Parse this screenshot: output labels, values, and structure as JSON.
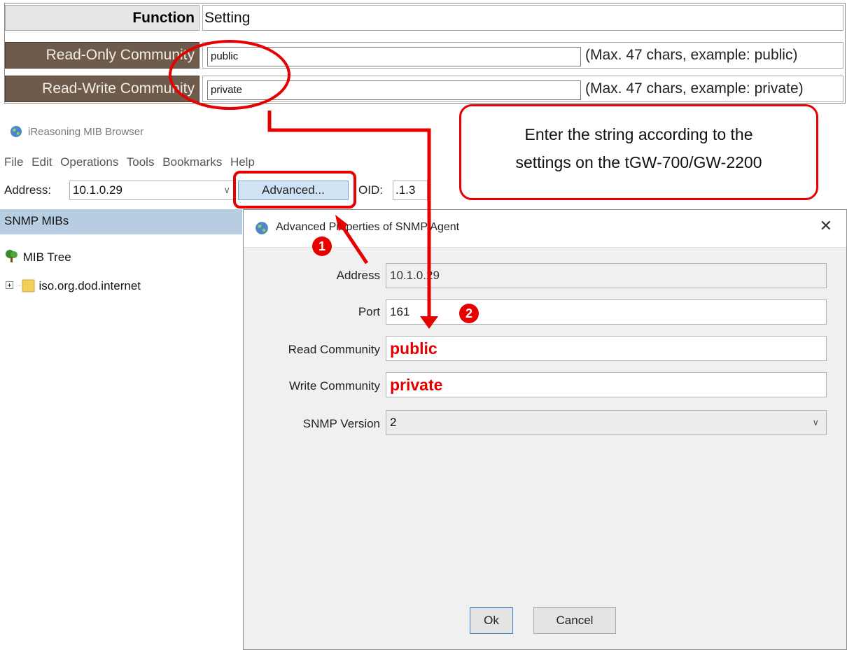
{
  "settings_table": {
    "header_label": "Function",
    "header_value": "Setting",
    "rows": [
      {
        "label": "Read-Only Community",
        "value": "public",
        "hint": "(Max. 47 chars, example: public)"
      },
      {
        "label": "Read-Write Community",
        "value": "private",
        "hint": "(Max. 47 chars, example: private)"
      }
    ]
  },
  "app": {
    "title": "iReasoning MIB Browser",
    "menu": [
      "File",
      "Edit",
      "Operations",
      "Tools",
      "Bookmarks",
      "Help"
    ],
    "address_label": "Address:",
    "address_value": "10.1.0.29",
    "advanced_button": "Advanced...",
    "oid_label": "OID:",
    "oid_value": ".1.3",
    "panel_header": "SNMP MIBs",
    "tree_root": "MIB Tree",
    "tree_child": "iso.org.dod.internet"
  },
  "dialog": {
    "title": "Advanced Properties of SNMP Agent",
    "close_glyph": "✕",
    "fields": {
      "address": {
        "label": "Address",
        "value": "10.1.0.29"
      },
      "port": {
        "label": "Port",
        "value": "161"
      },
      "read_community": {
        "label": "Read Community",
        "value": "public"
      },
      "write_community": {
        "label": "Write Community",
        "value": "private"
      },
      "snmp_version": {
        "label": "SNMP Version",
        "value": "2"
      }
    },
    "ok_button": "Ok",
    "cancel_button": "Cancel"
  },
  "annotations": {
    "callout_line1": "Enter the string according to the",
    "callout_line2": "settings on the tGW-700/GW-2200",
    "step1": "1",
    "step2": "2",
    "accent_color": "#e60000"
  }
}
